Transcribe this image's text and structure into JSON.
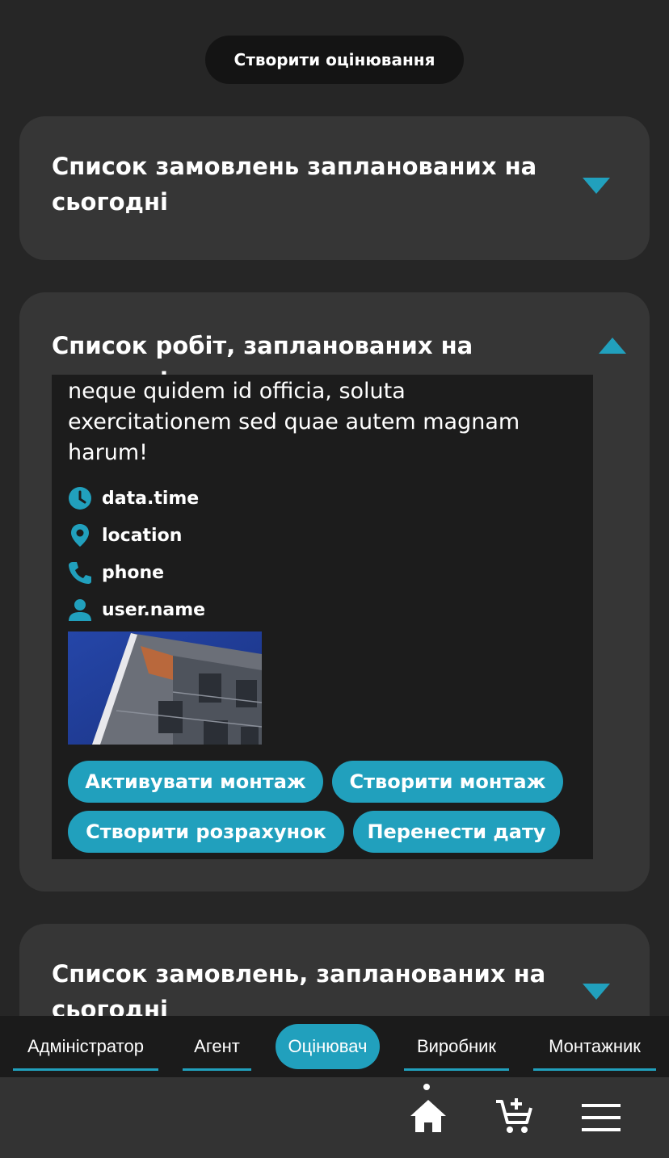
{
  "create_button": "Створити оцінювання",
  "cards": [
    {
      "title": "Список замовлень запланованих на сьогодні"
    },
    {
      "title": "Список робіт, запланованих на сьогодні"
    },
    {
      "title": "Список замовлень, запланованих на сьогодні"
    }
  ],
  "job": {
    "description": "adipisicing elit. Molestiae inventore sint neque quidem id officia, soluta exercitationem sed quae autem magnam harum!",
    "datetime": "data.time",
    "location": "location",
    "phone": "phone",
    "user": "user.name",
    "actions": [
      "Активувати монтаж",
      "Створити монтаж",
      "Створити розрахунок",
      "Перенести дату"
    ]
  },
  "roles": [
    "Адміністратор",
    "Агент",
    "Оцінювач",
    "Виробник",
    "Монтажник"
  ],
  "active_role": "Оцінювач",
  "nav_icons": [
    "home-icon",
    "add-to-cart-icon",
    "menu-icon"
  ],
  "colors": {
    "accent": "#21a0bd",
    "background": "#262626",
    "card": "#363636",
    "panel": "#1c1c1c"
  }
}
